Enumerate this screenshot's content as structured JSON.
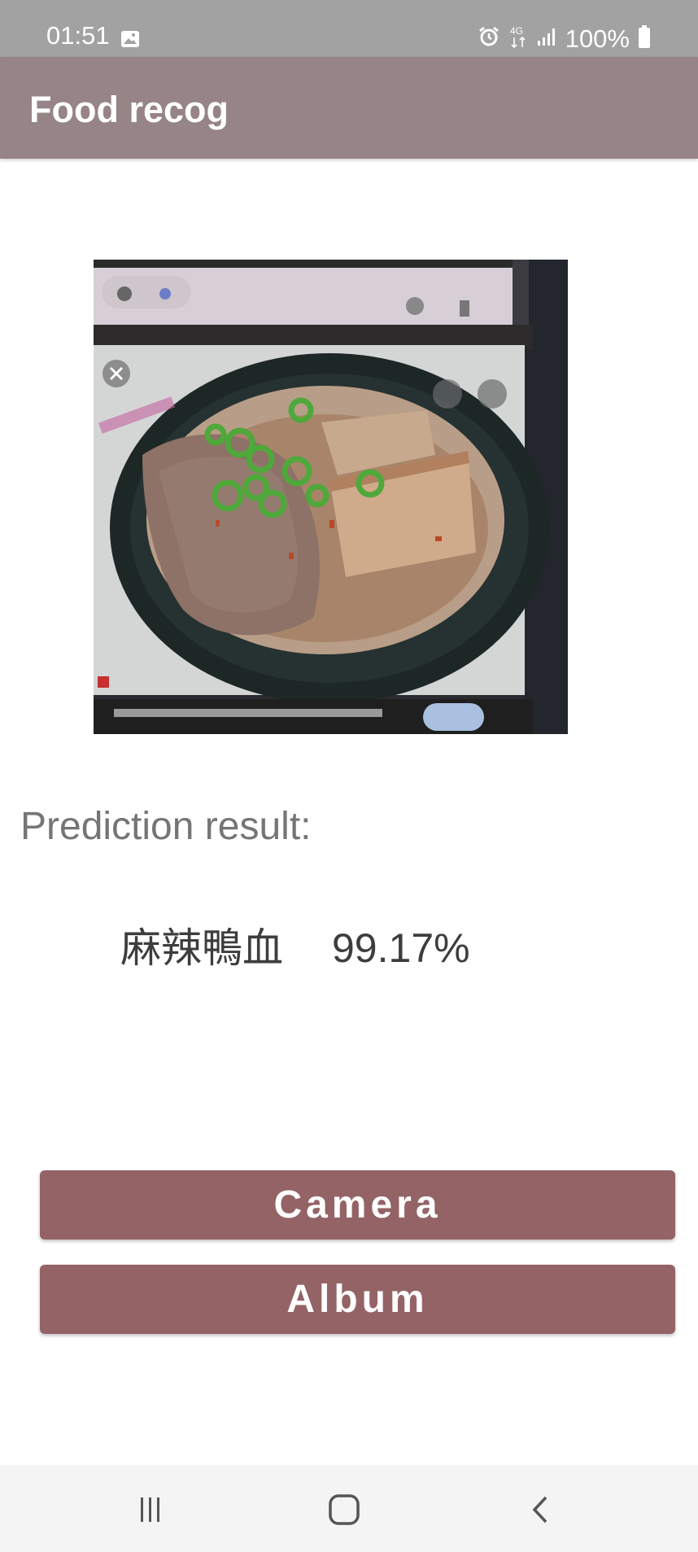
{
  "status_bar": {
    "time": "01:51",
    "network": "4G",
    "battery": "100%",
    "icons": [
      "gallery-icon",
      "alarm-icon",
      "network-4g-icon",
      "signal-icon",
      "battery-icon"
    ]
  },
  "app_bar": {
    "title": "Food recog"
  },
  "image": {
    "description_icon": "food-photo"
  },
  "prediction": {
    "label": "Prediction result:",
    "food_name": "麻辣鴨血",
    "confidence": "99.17%"
  },
  "buttons": {
    "camera": "Camera",
    "album": "Album"
  },
  "nav_bar": {
    "icons": [
      "recents-icon",
      "home-icon",
      "back-icon"
    ]
  },
  "colors": {
    "status_bar": "#a2a2a2",
    "app_bar": "#968486",
    "button": "#946366",
    "nav_bar": "#f4f4f4"
  }
}
